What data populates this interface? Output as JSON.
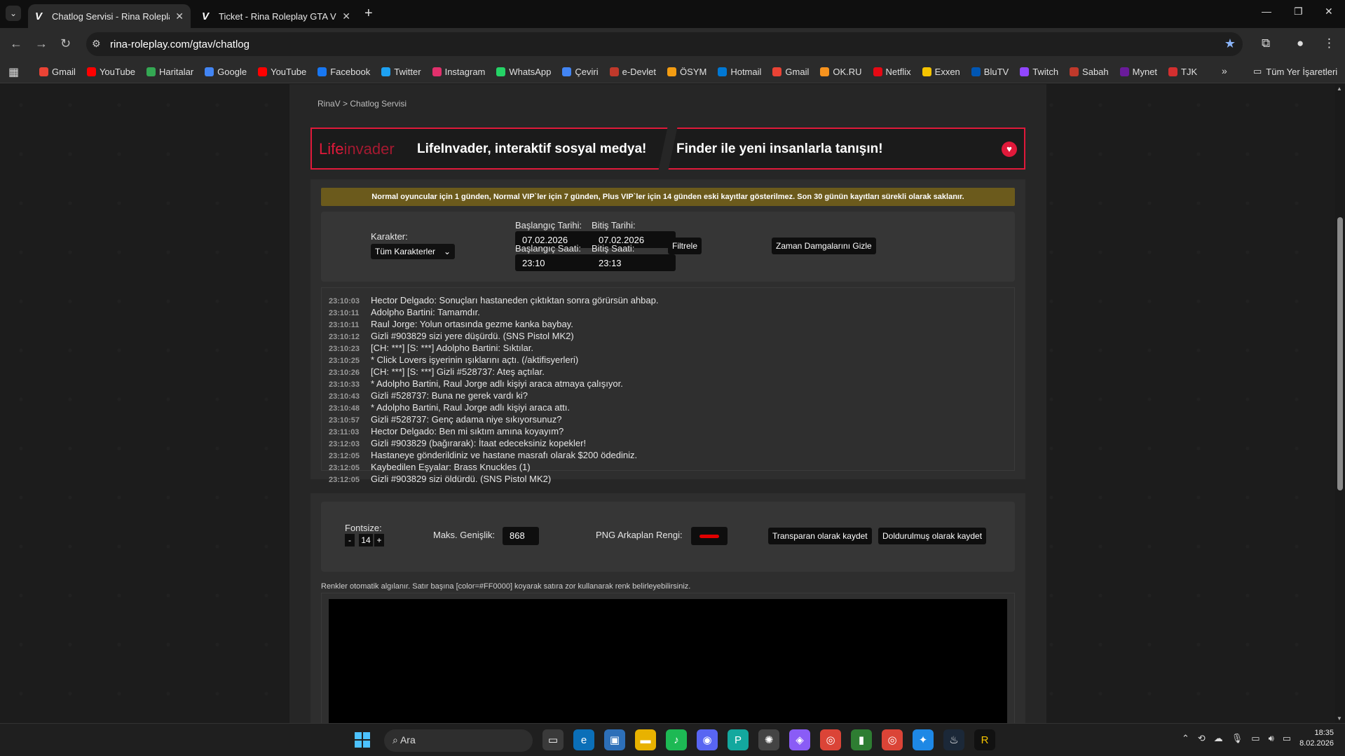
{
  "browser": {
    "tabs": [
      {
        "title": "Chatlog Servisi - Rina Roleplay",
        "active": true
      },
      {
        "title": "Ticket - Rina Roleplay GTA V | v",
        "active": false
      }
    ],
    "url": "rina-roleplay.com/gtav/chatlog",
    "bookmarks": [
      {
        "label": "Gmail",
        "color": "#ea4335"
      },
      {
        "label": "YouTube",
        "color": "#ff0000"
      },
      {
        "label": "Haritalar",
        "color": "#34a853"
      },
      {
        "label": "Google",
        "color": "#4285f4"
      },
      {
        "label": "YouTube",
        "color": "#ff0000"
      },
      {
        "label": "Facebook",
        "color": "#1877f2"
      },
      {
        "label": "Twitter",
        "color": "#1da1f2"
      },
      {
        "label": "Instagram",
        "color": "#e1306c"
      },
      {
        "label": "WhatsApp",
        "color": "#25d366"
      },
      {
        "label": "Çeviri",
        "color": "#4285f4"
      },
      {
        "label": "e-Devlet",
        "color": "#c0392b"
      },
      {
        "label": "ÖSYM",
        "color": "#f39c12"
      },
      {
        "label": "Hotmail",
        "color": "#0078d4"
      },
      {
        "label": "Gmail",
        "color": "#ea4335"
      },
      {
        "label": "OK.RU",
        "color": "#f7931e"
      },
      {
        "label": "Netflix",
        "color": "#e50914"
      },
      {
        "label": "Exxen",
        "color": "#f5c400"
      },
      {
        "label": "BluTV",
        "color": "#0056b3"
      },
      {
        "label": "Twitch",
        "color": "#9146ff"
      },
      {
        "label": "Sabah",
        "color": "#c0392b"
      },
      {
        "label": "Mynet",
        "color": "#6a1b9a"
      },
      {
        "label": "TJK",
        "color": "#d32f2f"
      }
    ],
    "all_bookmarks": "Tüm Yer İşaretleri"
  },
  "page": {
    "breadcrumb": {
      "root": "RinaV",
      "sep": ">",
      "current": "Chatlog Servisi"
    },
    "banner": {
      "logo_bold": "Life",
      "logo_thin": "invader",
      "left_text": "LifeInvader, interaktif sosyal medya!",
      "right_text": "Finder ile yeni insanlarla tanışın!"
    },
    "notice": "Normal oyuncular için 1 günden, Normal VIP`ler için 7 günden, Plus VIP`ler için 14 günden eski kayıtlar gösterilmez. Son 30 günün kayıtları sürekli olarak saklanır.",
    "filter": {
      "character_label": "Karakter:",
      "character_value": "Tüm Karakterler",
      "start_date_label": "Başlangıç Tarihi:",
      "start_date": "07.02.2026",
      "end_date_label": "Bitiş Tarihi:",
      "end_date": "07.02.2026",
      "start_time_label": "Başlangıç Saati:",
      "start_time": "23:10",
      "end_time_label": "Bitiş Saati:",
      "end_time": "23:13",
      "filter_button": "Filtrele",
      "hide_timestamps_button": "Zaman Damgalarını Gizle"
    },
    "log": [
      {
        "ts": "23:10:03",
        "text": "Hector Delgado: Sonuçları hastaneden çıktıktan sonra görürsün ahbap."
      },
      {
        "ts": "23:10:11",
        "text": "Adolpho Bartini: Tamamdır."
      },
      {
        "ts": "23:10:11",
        "text": "Raul Jorge: Yolun ortasında gezme kanka baybay."
      },
      {
        "ts": "23:10:12",
        "text": "Gizli #903829 sizi yere düşürdü. (SNS Pistol MK2)"
      },
      {
        "ts": "23:10:23",
        "text": "[CH: ***] [S: ***] Adolpho Bartini: Sıktılar."
      },
      {
        "ts": "23:10:25",
        "text": "* Click Lovers işyerinin ışıklarını açtı. (/aktifisyerleri)"
      },
      {
        "ts": "23:10:26",
        "text": "[CH: ***] [S: ***] Gizli #528737: Ateş açtılar."
      },
      {
        "ts": "23:10:33",
        "text": "* Adolpho Bartini, Raul Jorge adlı kişiyi araca atmaya çalışıyor."
      },
      {
        "ts": "23:10:43",
        "text": "Gizli #528737: Buna ne gerek vardı ki?"
      },
      {
        "ts": "23:10:48",
        "text": "* Adolpho Bartini, Raul Jorge adlı kişiyi araca attı."
      },
      {
        "ts": "23:10:57",
        "text": "Gizli #528737: Genç adama niye sıkıyorsunuz?"
      },
      {
        "ts": "23:11:03",
        "text": "Hector Delgado: Ben mi sıktım amına koyayım?"
      },
      {
        "ts": "23:12:03",
        "text": "Gizli #903829 (bağırarak): İtaat edeceksiniz kopekler!"
      },
      {
        "ts": "23:12:05",
        "text": "Hastaneye gönderildiniz ve hastane masrafı olarak $200 ödediniz."
      },
      {
        "ts": "23:12:05",
        "text": "Kaybedilen Eşyalar: Brass Knuckles (1)"
      },
      {
        "ts": "23:12:05",
        "text": "Gizli #903829 sizi öldürdü. (SNS Pistol MK2)"
      }
    ],
    "editor": {
      "fontsize_label": "Fontsize:",
      "fontsize_minus": "-",
      "fontsize_value": "14",
      "fontsize_plus": "+",
      "max_width_label": "Maks. Genişlik:",
      "max_width_value": "868",
      "png_bg_label": "PNG Arkaplan Rengi:",
      "png_bg_color": "#e00000",
      "save_transparent": "Transparan olarak kaydet",
      "save_filled": "Doldurulmuş olarak kaydet"
    },
    "hint": "Renkler otomatik algılanır. Satır başına [color=#FF0000] koyarak satıra zor kullanarak renk belirleyebilirsiniz."
  },
  "taskbar": {
    "search_placeholder": "Ara",
    "time": "18:35",
    "date": "8.02.2026"
  }
}
